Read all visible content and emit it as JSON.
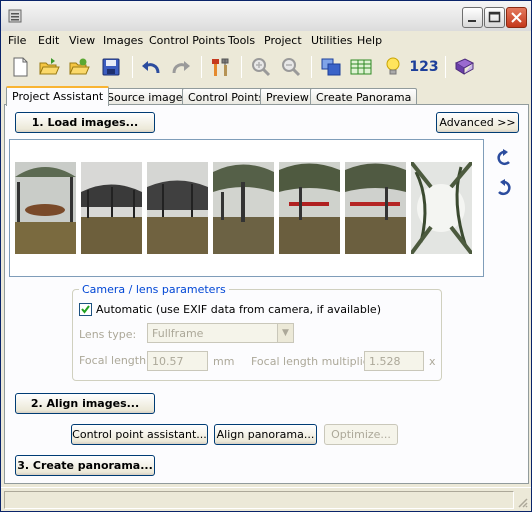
{
  "menu": [
    "File",
    "Edit",
    "View",
    "Images",
    "Control Points",
    "Tools",
    "Project",
    "Utilities",
    "Help"
  ],
  "toolbar": {
    "icons": [
      "new-project-icon",
      "open-project-icon",
      "open-recent-icon",
      "save-icon",
      "undo-icon",
      "redo-icon",
      "tools-icon",
      "zoom-in-icon",
      "zoom-out-icon",
      "preview-icon",
      "table-icon",
      "optimize-bulb-icon",
      "numbers-icon",
      "help-book-icon"
    ],
    "numbers_label": "123"
  },
  "tabs": [
    "Project Assistant",
    "Source images",
    "Control Points",
    "Preview",
    "Create Panorama"
  ],
  "assistant": {
    "load_images": "1. Load images...",
    "advanced": "Advanced >>",
    "align_images": "2. Align images...",
    "cp_assistant": "Control point assistant...",
    "align_panorama": "Align panorama...",
    "optimize": "Optimize...",
    "create_panorama": "3. Create panorama..."
  },
  "thumbnails": [
    "image-1",
    "image-2",
    "image-3",
    "image-4",
    "image-5",
    "image-6",
    "image-7"
  ],
  "lens": {
    "title": "Camera / lens parameters",
    "automatic_label": "Automatic (use EXIF data from camera, if available)",
    "automatic_checked": true,
    "lens_type_label": "Lens type:",
    "lens_type_value": "Fullframe",
    "focal_length_label": "Focal length:",
    "focal_length_value": "10.57",
    "focal_length_unit": "mm",
    "multiplier_label": "Focal length multiplier:",
    "multiplier_value": "1.528",
    "multiplier_unit": "x"
  }
}
